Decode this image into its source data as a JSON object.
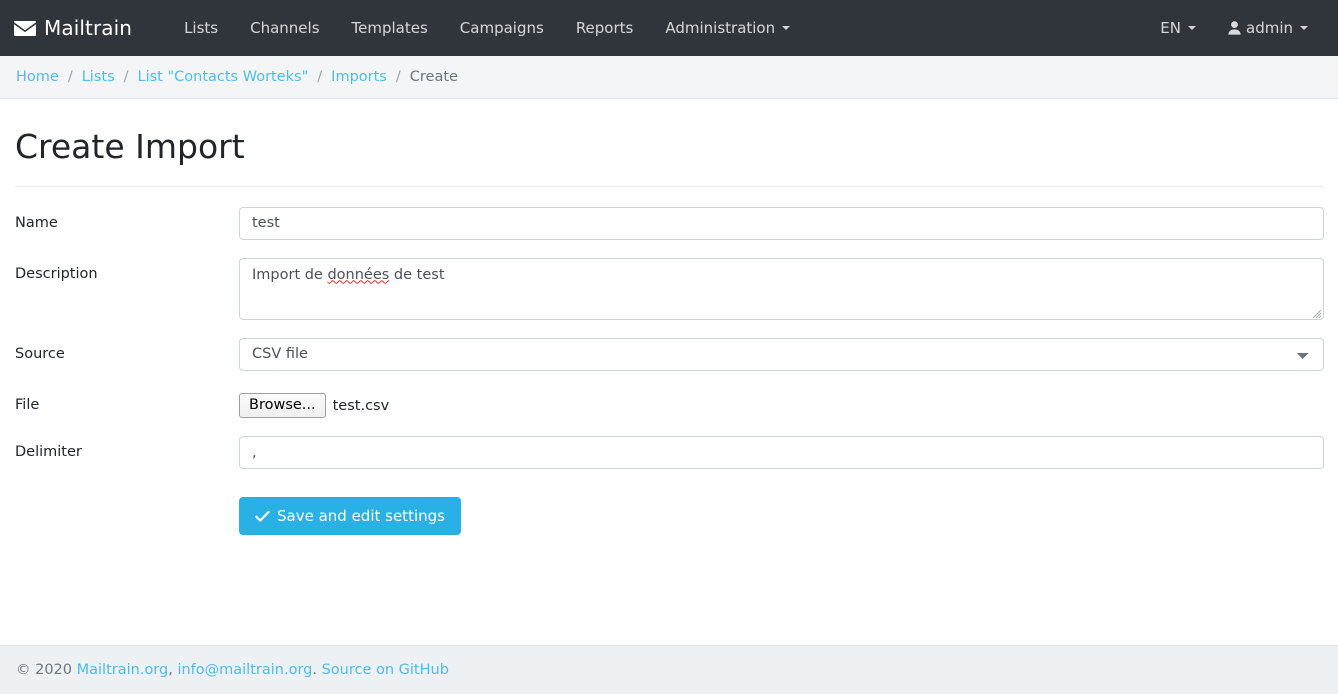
{
  "navbar": {
    "brand": "Mailtrain",
    "brand_icon": "envelope-icon",
    "links": [
      {
        "label": "Lists"
      },
      {
        "label": "Channels"
      },
      {
        "label": "Templates"
      },
      {
        "label": "Campaigns"
      },
      {
        "label": "Reports"
      },
      {
        "label": "Administration",
        "has_caret": true
      }
    ],
    "language": "EN",
    "user": "admin",
    "user_icon": "user-icon",
    "background_color": "#30353b"
  },
  "breadcrumb": {
    "items": [
      {
        "label": "Home",
        "link": true
      },
      {
        "label": "Lists",
        "link": true
      },
      {
        "label": "List \"Contacts Worteks\"",
        "link": true
      },
      {
        "label": "Imports",
        "link": true
      },
      {
        "label": "Create",
        "link": false
      }
    ],
    "separator": "/",
    "link_color": "#4dbce9"
  },
  "page": {
    "title": "Create Import"
  },
  "form": {
    "name": {
      "label": "Name",
      "value": "test",
      "placeholder": ""
    },
    "description": {
      "label": "Description",
      "value": "Import de données de test",
      "value_before_misspelling": "Import de ",
      "misspelled_word": "données",
      "value_after_misspelling": " de test",
      "placeholder": ""
    },
    "source": {
      "label": "Source",
      "value": "CSV file",
      "options": [
        "CSV file"
      ],
      "icon": "chevron-down-icon"
    },
    "file": {
      "label": "File",
      "browse_label": "Browse...",
      "file_name": "test.csv"
    },
    "delimiter": {
      "label": "Delimiter",
      "value": ",",
      "placeholder": ""
    },
    "submit": {
      "label": "Save and edit settings",
      "icon": "check-icon",
      "color": "#29b0e4"
    }
  },
  "footer": {
    "copyright": "© 2020 ",
    "link1": "Mailtrain.org",
    "comma": ", ",
    "link2": "info@mailtrain.org",
    "period": ". ",
    "link3": "Source on GitHub"
  }
}
